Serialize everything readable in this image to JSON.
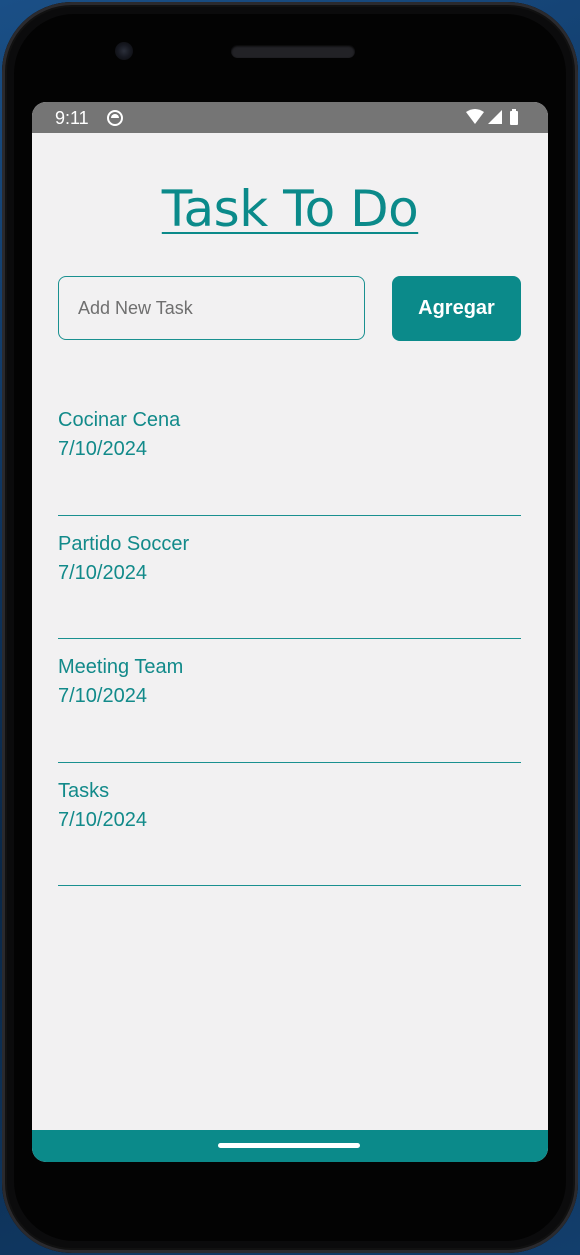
{
  "status_bar": {
    "time": "9:11",
    "icons": [
      "app-notification-icon",
      "wifi-icon",
      "cellular-signal-icon",
      "battery-icon"
    ]
  },
  "app": {
    "title": "Task To Do",
    "input": {
      "placeholder": "Add New Task",
      "value": ""
    },
    "add_button_label": "Agregar",
    "accent_color": "#0b8a8a"
  },
  "tasks": [
    {
      "name": "Cocinar Cena",
      "date": "7/10/2024"
    },
    {
      "name": "Partido Soccer",
      "date": "7/10/2024"
    },
    {
      "name": "Meeting Team",
      "date": "7/10/2024"
    },
    {
      "name": "Tasks",
      "date": "7/10/2024"
    }
  ]
}
